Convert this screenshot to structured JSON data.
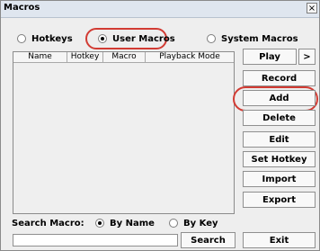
{
  "window": {
    "title": "Macros",
    "close_label": "×"
  },
  "modes": {
    "hotkeys": "Hotkeys",
    "user_macros": "User Macros",
    "system_macros": "System Macros",
    "selected": "User Macros"
  },
  "table": {
    "headers": [
      "Name",
      "Hotkey",
      "Macro",
      "Playback Mode"
    ]
  },
  "buttons": {
    "play": "Play",
    "arrow": ">",
    "record": "Record",
    "add": "Add",
    "delete": "Delete",
    "edit": "Edit",
    "set_hotkey": "Set Hotkey",
    "import": "Import",
    "export": "Export",
    "search": "Search",
    "exit": "Exit"
  },
  "search": {
    "label": "Search Macro:",
    "by_name": "By Name",
    "by_key": "By Key",
    "selected": "By Name",
    "value": ""
  },
  "highlight": {
    "color": "#d23b33"
  }
}
